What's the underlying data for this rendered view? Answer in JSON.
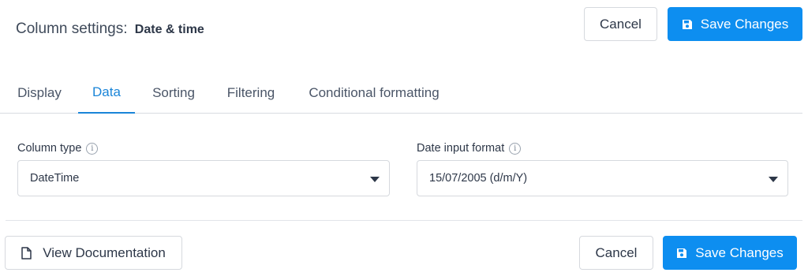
{
  "header": {
    "title_prefix": "Column settings:",
    "title_column": "Date & time",
    "cancel_label": "Cancel",
    "save_label": "Save Changes"
  },
  "tabs": [
    {
      "label": "Display"
    },
    {
      "label": "Data"
    },
    {
      "label": "Sorting"
    },
    {
      "label": "Filtering"
    },
    {
      "label": "Conditional formatting"
    }
  ],
  "active_tab": "Data",
  "fields": {
    "column_type": {
      "label": "Column type",
      "value": "DateTime"
    },
    "date_input_format": {
      "label": "Date input format",
      "value": "15/07/2005 (d/m/Y)"
    }
  },
  "footer": {
    "docs_label": "View Documentation",
    "cancel_label": "Cancel",
    "save_label": "Save Changes"
  },
  "colors": {
    "primary": "#0d8ef0",
    "active_tab": "#1a85d8",
    "border": "#d6d9de",
    "text": "#2d3748"
  },
  "icons": {
    "save": "floppy-disk-icon",
    "info": "info-circle-icon",
    "document": "document-icon",
    "dropdown": "caret-down-icon"
  }
}
